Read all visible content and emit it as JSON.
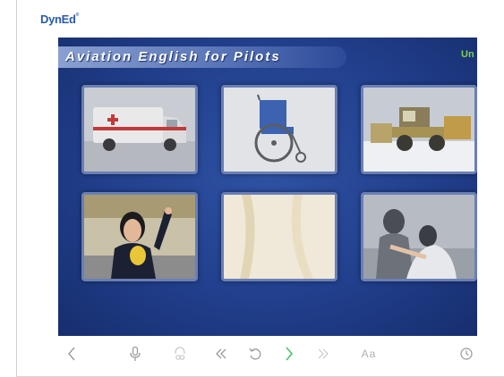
{
  "logo": {
    "brand": "DynEd"
  },
  "lesson": {
    "title": "Aviation English for Pilots",
    "unit_label": "Un"
  },
  "thumbnails": [
    {
      "name": "ambulance"
    },
    {
      "name": "wheelchair"
    },
    {
      "name": "bulldozer-in-snow"
    },
    {
      "name": "woman-with-megaphone"
    },
    {
      "name": "light-pattern"
    },
    {
      "name": "person-helping-person"
    }
  ],
  "controls": {
    "text_size_label": "Aa",
    "items": [
      {
        "icon": "chevron-left-icon"
      },
      {
        "icon": "microphone-icon"
      },
      {
        "icon": "ear-playback-icon"
      },
      {
        "icon": "rewind-icon"
      },
      {
        "icon": "repeat-icon"
      },
      {
        "icon": "chevron-right-icon"
      },
      {
        "icon": "fast-forward-icon"
      },
      {
        "icon": "text-size-icon"
      },
      {
        "icon": "clock-icon"
      }
    ]
  },
  "colors": {
    "stage_blue": "#213f8c",
    "logo_blue": "#2a5aa8",
    "next_green": "#4cc26a",
    "unit_green": "#7cd34a"
  }
}
